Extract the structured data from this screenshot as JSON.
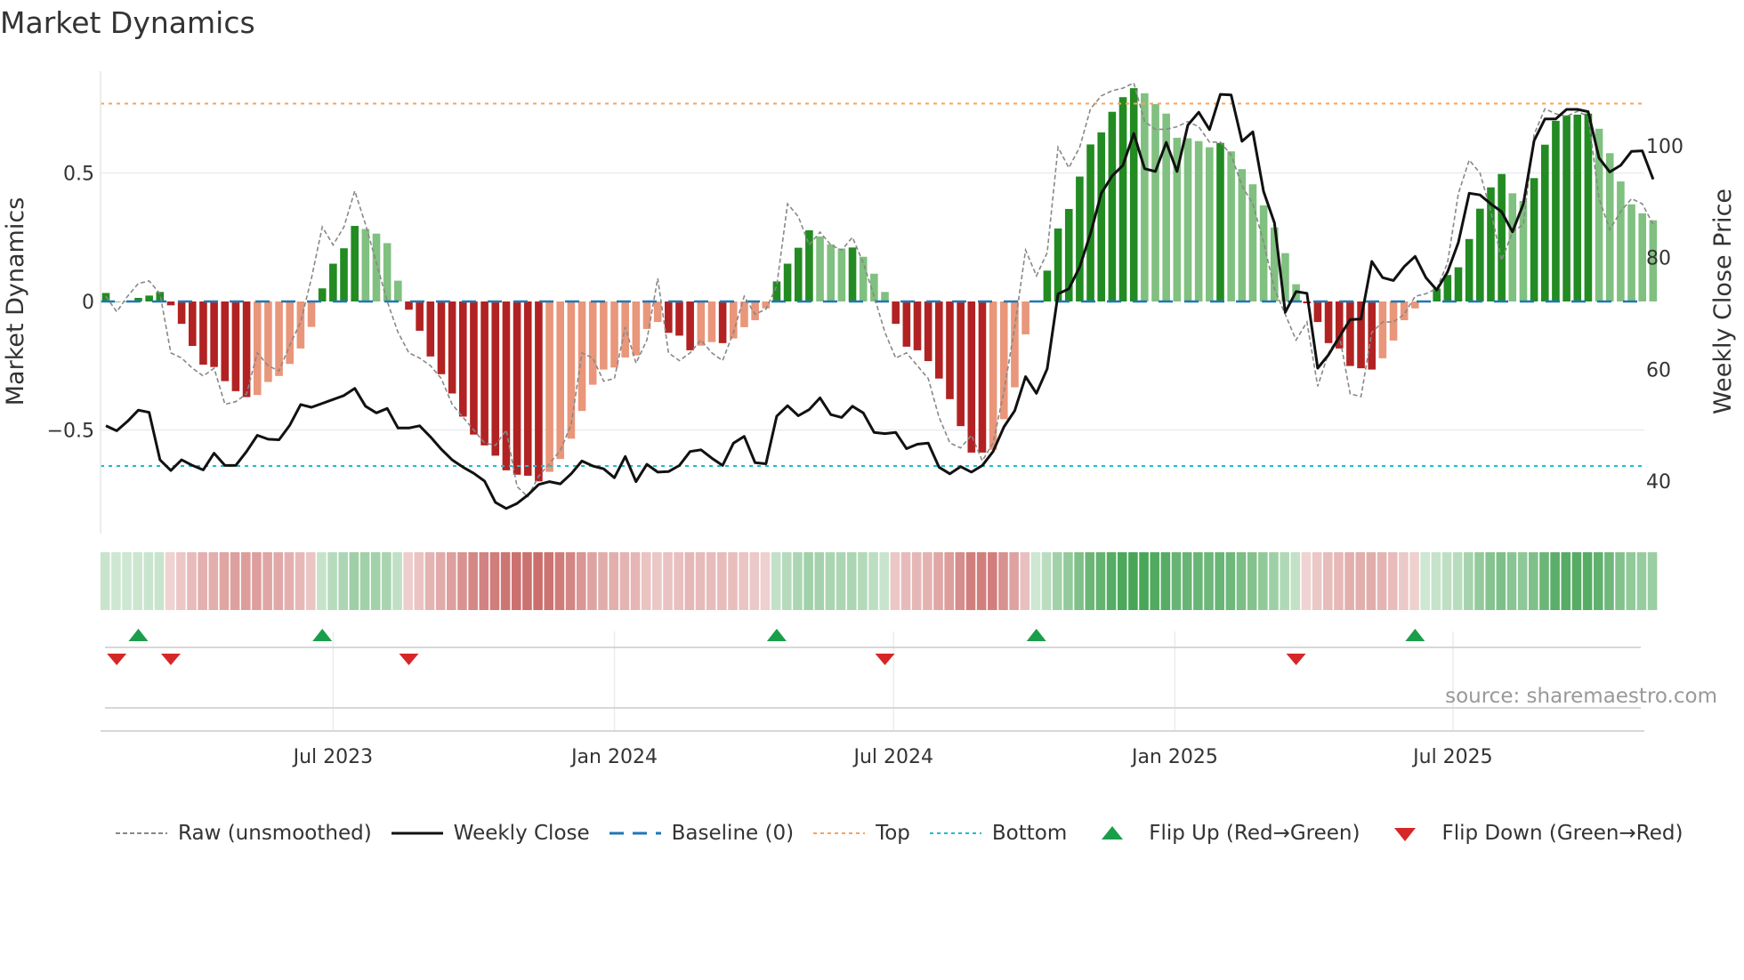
{
  "chart_data": {
    "type": "bar",
    "title": "Market Dynamics",
    "ylabel": "Market Dynamics",
    "y2label": "Weekly Close Price",
    "ylim": [
      -0.92,
      0.9
    ],
    "y2lim": [
      30,
      119
    ],
    "yticks": [
      {
        "v": 0.5,
        "label": "0.5"
      },
      {
        "v": 0,
        "label": "0"
      },
      {
        "v": -0.5,
        "label": "−0.5"
      }
    ],
    "y2ticks": [
      {
        "v": 100,
        "label": "100"
      },
      {
        "v": 80,
        "label": "80"
      },
      {
        "v": 60,
        "label": "60"
      },
      {
        "v": 40,
        "label": "40"
      }
    ],
    "xticks": [
      {
        "week": 21,
        "label": "Jul 2023"
      },
      {
        "week": 47,
        "label": "Jan 2024"
      },
      {
        "week": 72.8,
        "label": "Jul 2024"
      },
      {
        "week": 98.8,
        "label": "Jan 2025"
      },
      {
        "week": 124.5,
        "label": "Jul 2025"
      }
    ],
    "top_level": 0.77,
    "bottom_level": -0.64,
    "baseline": 0,
    "dynamics": [
      0.033,
      0.0,
      0.0,
      0.014,
      0.023,
      0.037,
      -0.015,
      -0.087,
      -0.173,
      -0.246,
      -0.255,
      -0.31,
      -0.349,
      -0.372,
      -0.364,
      -0.313,
      -0.29,
      -0.243,
      -0.183,
      -0.099,
      0.051,
      0.147,
      0.207,
      0.294,
      0.282,
      0.264,
      0.227,
      0.081,
      -0.032,
      -0.114,
      -0.214,
      -0.283,
      -0.358,
      -0.448,
      -0.518,
      -0.56,
      -0.6,
      -0.657,
      -0.674,
      -0.678,
      -0.7,
      -0.663,
      -0.613,
      -0.534,
      -0.426,
      -0.324,
      -0.265,
      -0.257,
      -0.218,
      -0.21,
      -0.107,
      -0.08,
      -0.122,
      -0.133,
      -0.19,
      -0.172,
      -0.158,
      -0.162,
      -0.144,
      -0.1,
      -0.073,
      -0.027,
      0.078,
      0.147,
      0.209,
      0.277,
      0.253,
      0.222,
      0.206,
      0.21,
      0.174,
      0.108,
      0.037,
      -0.087,
      -0.176,
      -0.19,
      -0.232,
      -0.3,
      -0.38,
      -0.485,
      -0.588,
      -0.588,
      -0.577,
      -0.458,
      -0.334,
      -0.128,
      0.0,
      0.12,
      0.284,
      0.36,
      0.486,
      0.611,
      0.658,
      0.738,
      0.795,
      0.83,
      0.81,
      0.768,
      0.731,
      0.637,
      0.635,
      0.624,
      0.6,
      0.617,
      0.584,
      0.515,
      0.456,
      0.374,
      0.288,
      0.188,
      0.067,
      -0.007,
      -0.08,
      -0.162,
      -0.183,
      -0.251,
      -0.26,
      -0.265,
      -0.221,
      -0.152,
      -0.073,
      -0.027,
      0.0,
      0.05,
      0.103,
      0.133,
      0.243,
      0.361,
      0.444,
      0.496,
      0.421,
      0.391,
      0.48,
      0.61,
      0.703,
      0.724,
      0.727,
      0.731,
      0.672,
      0.577,
      0.467,
      0.378,
      0.343,
      0.316
    ],
    "raw": [
      0.02,
      -0.04,
      0.02,
      0.07,
      0.08,
      0.03,
      -0.2,
      -0.22,
      -0.26,
      -0.29,
      -0.26,
      -0.4,
      -0.39,
      -0.36,
      -0.2,
      -0.25,
      -0.27,
      -0.17,
      -0.08,
      0.09,
      0.29,
      0.22,
      0.29,
      0.43,
      0.3,
      0.15,
      0.0,
      -0.12,
      -0.2,
      -0.22,
      -0.25,
      -0.3,
      -0.4,
      -0.45,
      -0.5,
      -0.55,
      -0.56,
      -0.5,
      -0.72,
      -0.76,
      -0.68,
      -0.63,
      -0.58,
      -0.48,
      -0.2,
      -0.22,
      -0.31,
      -0.3,
      -0.1,
      -0.24,
      -0.15,
      0.09,
      -0.2,
      -0.23,
      -0.2,
      -0.15,
      -0.2,
      -0.23,
      -0.12,
      0.02,
      -0.05,
      -0.03,
      0.06,
      0.38,
      0.33,
      0.22,
      0.27,
      0.22,
      0.2,
      0.25,
      0.15,
      0.02,
      -0.12,
      -0.22,
      -0.2,
      -0.25,
      -0.3,
      -0.45,
      -0.55,
      -0.57,
      -0.52,
      -0.62,
      -0.55,
      -0.35,
      -0.1,
      0.2,
      0.1,
      0.19,
      0.6,
      0.52,
      0.6,
      0.75,
      0.8,
      0.82,
      0.83,
      0.85,
      0.7,
      0.67,
      0.67,
      0.68,
      0.7,
      0.68,
      0.62,
      0.62,
      0.57,
      0.45,
      0.38,
      0.23,
      0.05,
      -0.05,
      -0.15,
      -0.08,
      -0.33,
      -0.2,
      -0.13,
      -0.36,
      -0.37,
      -0.12,
      -0.08,
      -0.08,
      -0.05,
      0.02,
      0.03,
      0.05,
      0.15,
      0.42,
      0.55,
      0.5,
      0.35,
      0.16,
      0.27,
      0.3,
      0.65,
      0.75,
      0.73,
      0.72,
      0.74,
      0.72,
      0.4,
      0.28,
      0.35,
      0.4,
      0.38,
      0.3
    ],
    "weekly_close": [
      49.9,
      49.0,
      50.7,
      52.7,
      52.3,
      43.8,
      41.9,
      43.8,
      42.8,
      42.0,
      45.0,
      42.8,
      42.8,
      45.3,
      48.2,
      47.5,
      47.4,
      50.0,
      53.7,
      53.2,
      53.9,
      54.6,
      55.3,
      56.6,
      53.4,
      52.2,
      53.0,
      49.5,
      49.5,
      49.9,
      47.9,
      45.7,
      43.8,
      42.5,
      41.4,
      40.0,
      36.2,
      35.1,
      36.0,
      37.5,
      39.4,
      39.9,
      39.5,
      41.3,
      43.6,
      42.7,
      42.2,
      40.6,
      44.4,
      39.9,
      43.0,
      41.6,
      41.7,
      42.8,
      45.3,
      45.6,
      44.1,
      42.8,
      46.8,
      48.0,
      43.3,
      43.1,
      51.6,
      53.5,
      51.7,
      52.8,
      54.9,
      51.9,
      51.4,
      53.4,
      52.2,
      48.7,
      48.5,
      48.7,
      45.8,
      46.6,
      46.8,
      42.5,
      41.3,
      42.6,
      41.6,
      42.8,
      45.3,
      49.7,
      52.6,
      58.7,
      55.7,
      60.1,
      73.5,
      74.4,
      78.3,
      84.3,
      91.5,
      94.6,
      96.5,
      102.2,
      95.9,
      95.4,
      100.6,
      95.4,
      103.7,
      106.0,
      102.9,
      109.2,
      109.1,
      100.8,
      102.5,
      91.8,
      86.2,
      70.2,
      73.9,
      73.6,
      60.2,
      62.6,
      65.8,
      68.9,
      69.0,
      79.3,
      76.4,
      75.9,
      78.4,
      80.2,
      76.4,
      74.2,
      77.4,
      82.7,
      91.5,
      91.2,
      89.6,
      88.2,
      84.6,
      89.6,
      100.9,
      104.8,
      104.8,
      106.5,
      106.5,
      106.1,
      97.8,
      95.3,
      96.5,
      99.0,
      99.1,
      94.0
    ],
    "flip_up_weeks": [
      3,
      20,
      62,
      86,
      121
    ],
    "flip_down_weeks": [
      1,
      6,
      28,
      72,
      110
    ],
    "legend": {
      "raw": "Raw (unsmoothed)",
      "close": "Weekly Close",
      "baseline": "Baseline (0)",
      "top": "Top",
      "bottom": "Bottom",
      "flip_up": "Flip Up (Red→Green)",
      "flip_down": "Flip Down (Green→Red)"
    },
    "legend_placement": "bottom",
    "source": "source: sharemaestro.com"
  },
  "colors": {
    "green_strong": "#228b22",
    "green_weak": "#80c080",
    "red_strong": "#b22222",
    "red_weak": "#e9967a",
    "top": "#f4a460",
    "bottom": "#17becf",
    "baseline": "#1f77b4",
    "flip_up": "#1a9e4a",
    "flip_down": "#d62728"
  }
}
